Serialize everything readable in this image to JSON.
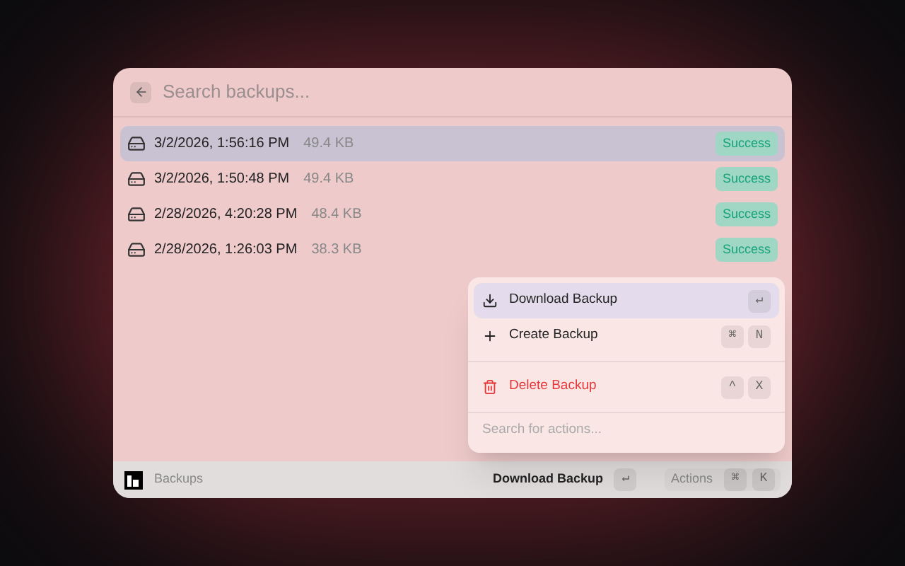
{
  "search": {
    "placeholder": "Search backups..."
  },
  "backups": [
    {
      "date": "3/2/2026, 1:56:16 PM",
      "size": "49.4 KB",
      "status": "Success",
      "selected": true
    },
    {
      "date": "3/2/2026, 1:50:48 PM",
      "size": "49.4 KB",
      "status": "Success",
      "selected": false
    },
    {
      "date": "2/28/2026, 4:20:28 PM",
      "size": "48.4 KB",
      "status": "Success",
      "selected": false
    },
    {
      "date": "2/28/2026, 1:26:03 PM",
      "size": "38.3 KB",
      "status": "Success",
      "selected": false
    }
  ],
  "actions_menu": {
    "items": [
      {
        "kind": "download",
        "label": "Download Backup",
        "keys": [
          "↵"
        ],
        "selected": true,
        "danger": false
      },
      {
        "kind": "create",
        "label": "Create Backup",
        "keys": [
          "⌘",
          "N"
        ],
        "selected": false,
        "danger": false
      },
      {
        "kind": "delete",
        "label": "Delete Backup",
        "keys": [
          "^",
          "X"
        ],
        "selected": false,
        "danger": true
      }
    ],
    "search": {
      "placeholder": "Search for actions..."
    }
  },
  "footer": {
    "title": "Backups",
    "primary_action": "Download Backup",
    "primary_keys": [
      "↵"
    ],
    "actions_label": "Actions",
    "actions_keys": [
      "⌘",
      "K"
    ]
  }
}
